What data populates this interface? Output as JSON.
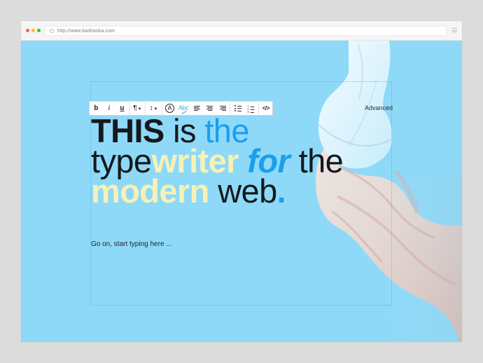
{
  "browser": {
    "url": "http://www.bashooka.com",
    "traffic_lights": [
      "#ff5f57",
      "#ffbd2e",
      "#28c840"
    ]
  },
  "page": {
    "background_color": "#8ed9f8"
  },
  "toolbar": {
    "bold": "b",
    "italic": "i",
    "underline": "u",
    "paragraph": "¶",
    "spacing": "↕",
    "text_color": "A",
    "spellcheck": "Abc",
    "code": "</>"
  },
  "advanced_label": "Advanced",
  "headline": {
    "line1": {
      "this": "THIS",
      "is": " is ",
      "the": "the"
    },
    "line2": {
      "type": "type",
      "writer": "writer",
      "space": " ",
      "for": "for",
      "the": " the"
    },
    "line3": {
      "modern": "modern",
      "web": " web",
      "period": "."
    }
  },
  "editor_placeholder": "Go on, start typing here ..."
}
